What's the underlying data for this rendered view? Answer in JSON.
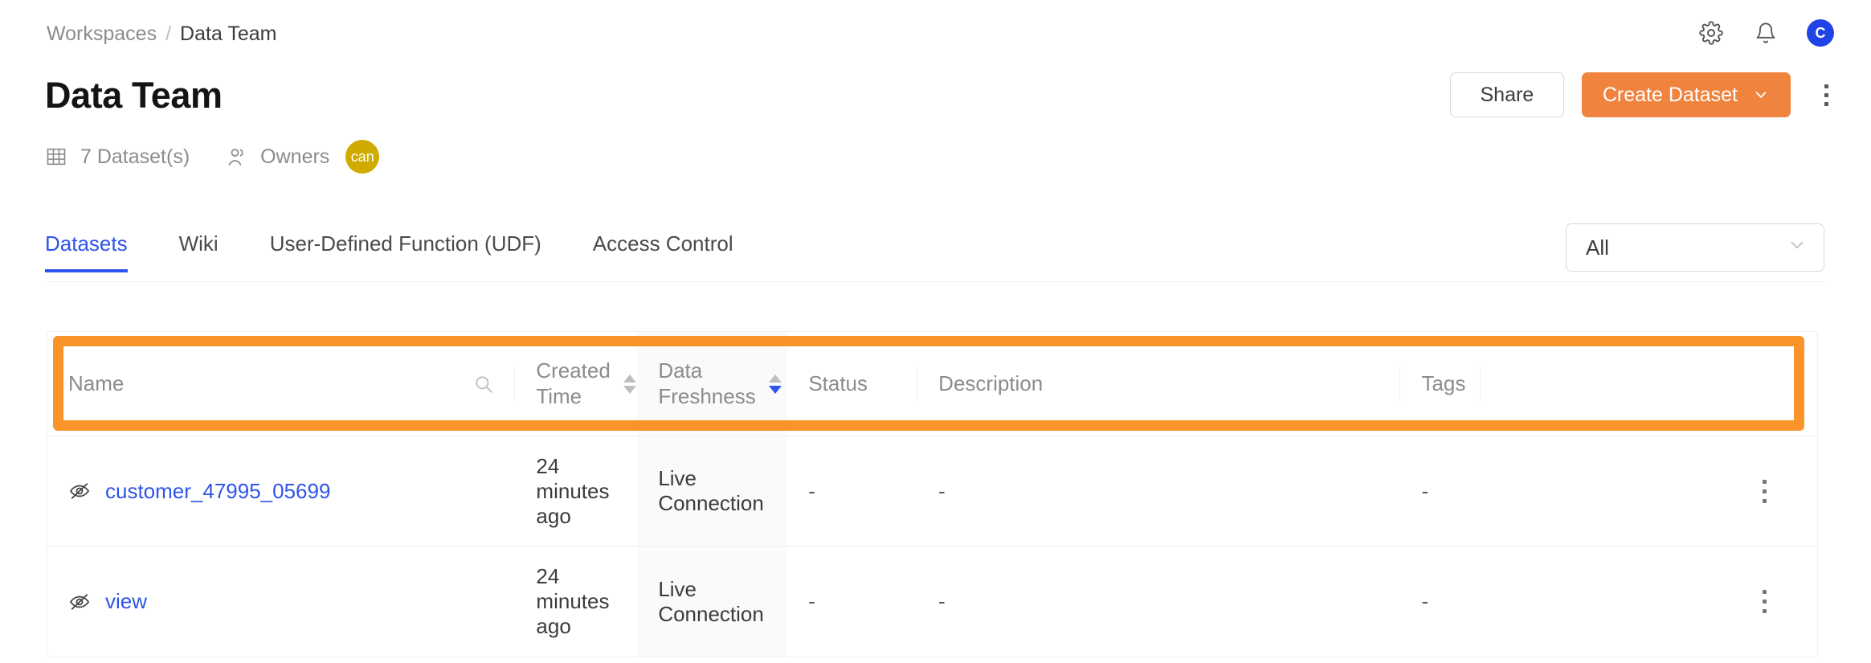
{
  "breadcrumb": {
    "root": "Workspaces",
    "separator": "/",
    "current": "Data Team"
  },
  "header": {
    "title": "Data Team",
    "share_label": "Share",
    "create_label": "Create Dataset",
    "icons": {
      "settings": "gear-icon",
      "notifications": "bell-icon",
      "account": "C",
      "more": "kebab-vertical-icon",
      "create_chevron": "chevron-down-icon"
    }
  },
  "meta": {
    "dataset_count": "7 Dataset(s)",
    "owners_label": "Owners",
    "owner_initials": "can",
    "owner_color": "#cfab00",
    "grid_icon": "table-grid-icon",
    "people_icon": "people-icon"
  },
  "tabs": [
    {
      "label": "Datasets",
      "active": true
    },
    {
      "label": "Wiki",
      "active": false
    },
    {
      "label": "User-Defined Function (UDF)",
      "active": false
    },
    {
      "label": "Access Control",
      "active": false
    }
  ],
  "filter": {
    "value": "All",
    "chevron": "chevron-down-icon"
  },
  "table": {
    "columns": [
      {
        "key": "name",
        "label": "Name",
        "sortable": false,
        "search": true,
        "sort": "none"
      },
      {
        "key": "time",
        "label": "Created\nTime",
        "sortable": true,
        "search": false,
        "sort": "none"
      },
      {
        "key": "fresh",
        "label": "Data\nFreshness",
        "sortable": true,
        "search": false,
        "sort": "desc",
        "highlighted": true
      },
      {
        "key": "status",
        "label": "Status",
        "sortable": false,
        "search": false,
        "sort": "none"
      },
      {
        "key": "desc",
        "label": "Description",
        "sortable": false,
        "search": false,
        "sort": "none"
      },
      {
        "key": "tags",
        "label": "Tags",
        "sortable": false,
        "search": false,
        "sort": "none"
      }
    ],
    "column_labels": {
      "name": "Name",
      "created_time_line1": "Created",
      "created_time_line2": "Time",
      "data_freshness_line1": "Data",
      "data_freshness_line2": "Freshness",
      "status": "Status",
      "description": "Description",
      "tags": "Tags"
    },
    "rows": [
      {
        "visibility_icon": "eye-off-icon",
        "name": "customer_47995_05699",
        "created_time": "24 minutes ago",
        "data_freshness": "Live Connection",
        "status": "-",
        "description": "-",
        "tags": "-",
        "row_menu": "kebab-vertical-icon"
      },
      {
        "visibility_icon": "eye-off-icon",
        "name": "view",
        "created_time": "24 minutes ago",
        "data_freshness": "Live Connection",
        "status": "-",
        "description": "-",
        "tags": "-",
        "row_menu": "kebab-vertical-icon"
      }
    ]
  },
  "annotation": {
    "highlight_color": "#fa9429",
    "target": "table-header-row"
  },
  "colors": {
    "primary_accent": "#f0833e",
    "link": "#2f54eb",
    "tab_active": "#2f54eb",
    "avatar_blue": "#1f43e5",
    "owner_gold": "#cfab00",
    "muted_text": "#8c8c8c",
    "column_highlight_bg": "#fafafa"
  }
}
